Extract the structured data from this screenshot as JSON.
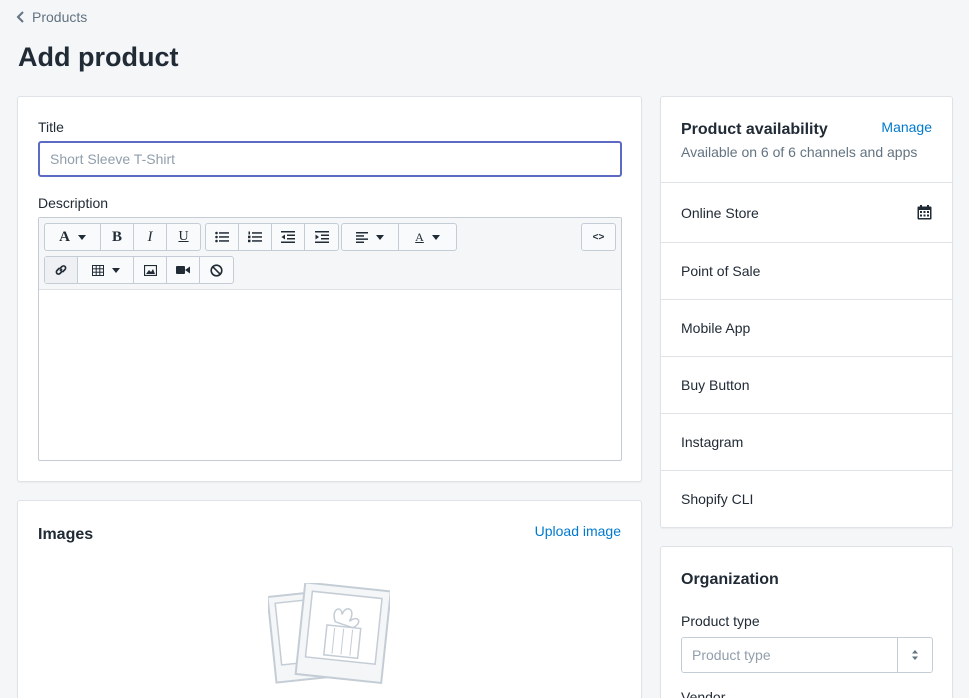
{
  "breadcrumb": {
    "label": "Products"
  },
  "page": {
    "title": "Add product"
  },
  "general": {
    "title_label": "Title",
    "title_placeholder": "Short Sleeve T-Shirt",
    "title_value": "",
    "description_label": "Description",
    "editor": {
      "bold": "B",
      "italic": "I",
      "underline": "U",
      "font": "A",
      "text_color": "A",
      "html_toggle": "<>"
    }
  },
  "images": {
    "heading": "Images",
    "upload_link": "Upload image"
  },
  "availability": {
    "heading": "Product availability",
    "manage_link": "Manage",
    "subtitle": "Available on 6 of 6 channels and apps",
    "channels": [
      {
        "name": "Online Store"
      },
      {
        "name": "Point of Sale"
      },
      {
        "name": "Mobile App"
      },
      {
        "name": "Buy Button"
      },
      {
        "name": "Instagram"
      },
      {
        "name": "Shopify CLI"
      }
    ]
  },
  "organization": {
    "heading": "Organization",
    "product_type_label": "Product type",
    "product_type_placeholder": "Product type",
    "vendor_label": "Vendor"
  },
  "colors": {
    "accent": "#5c6ac4",
    "link": "#007ace",
    "background": "#f4f6f8"
  }
}
